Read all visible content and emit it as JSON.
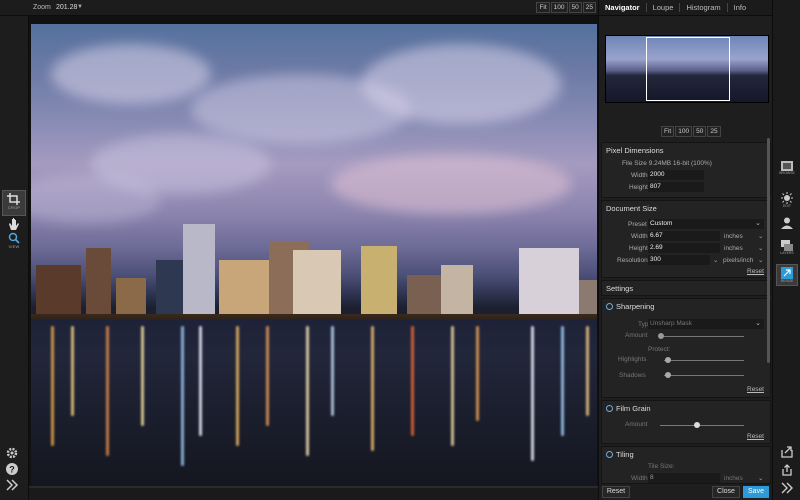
{
  "topbar": {
    "zoom_label": "Zoom",
    "zoom_value": "201.28",
    "zoom_buttons": [
      "Fit",
      "100",
      "50",
      "25"
    ]
  },
  "left_tools": [
    {
      "label": "CROP"
    },
    {
      "label": "VIEW"
    }
  ],
  "right_panel": {
    "tabs": [
      "Navigator",
      "Loupe",
      "Histogram",
      "Info"
    ],
    "nav_buttons": [
      "Fit",
      "100",
      "50",
      "25"
    ],
    "pixel_dimensions": {
      "title": "Pixel Dimensions",
      "file_size": "File Size 9.24MB 16-bit (100%)",
      "width_label": "Width",
      "width_value": "2000",
      "height_label": "Height",
      "height_value": "807"
    },
    "document_size": {
      "title": "Document Size",
      "preset_label": "Preset",
      "preset_value": "Custom",
      "width_label": "Width",
      "width_value": "6.67",
      "width_unit": "inches",
      "height_label": "Height",
      "height_value": "2.69",
      "height_unit": "inches",
      "resolution_label": "Resolution",
      "resolution_value": "300",
      "resolution_unit": "pixels/inch",
      "reset": "Reset"
    },
    "settings": {
      "title": "Settings"
    },
    "sharpening": {
      "title": "Sharpening",
      "type_label": "Type",
      "type_value": "Unsharp Mask",
      "amount_label": "Amount",
      "protect_label": "Protect:",
      "highlights_label": "Highlights",
      "shadows_label": "Shadows",
      "reset": "Reset"
    },
    "film_grain": {
      "title": "Film Grain",
      "amount_label": "Amount",
      "reset": "Reset"
    },
    "tiling": {
      "title": "Tiling",
      "tile_size_label": "Tile Size:",
      "width_label": "Width",
      "width_value": "8",
      "width_unit": "inches"
    }
  },
  "right_tools": [
    {
      "label": "BROWSE"
    },
    {
      "label": "EDIT"
    },
    {
      "label": "LAYERS"
    },
    {
      "label": "RESIZE"
    }
  ],
  "footer": {
    "reset": "Reset",
    "close": "Close",
    "save": "Save"
  },
  "colors": {
    "accent": "#2d9bd8",
    "panel_bg": "#1e1e1e"
  }
}
